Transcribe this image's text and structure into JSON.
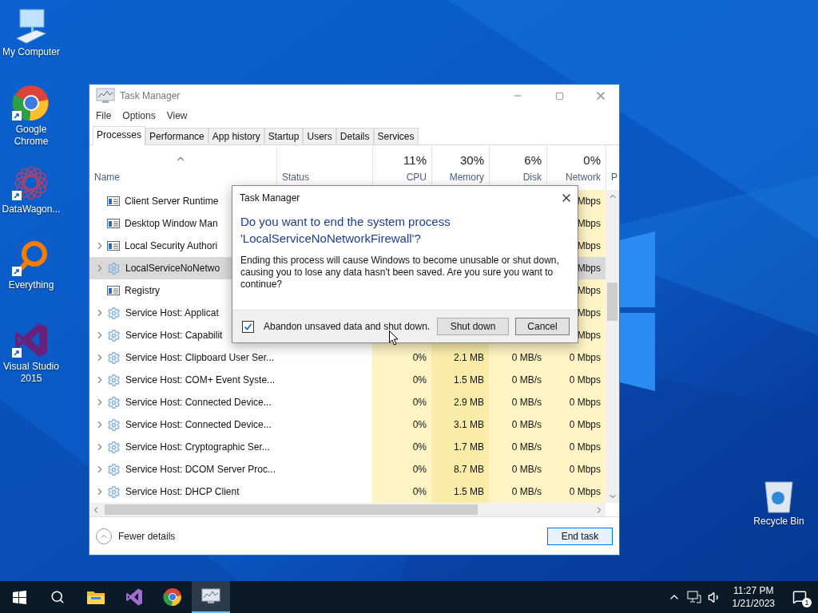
{
  "desktop_icons": [
    {
      "label": "My Computer",
      "kind": "computer",
      "shortcut": false
    },
    {
      "label": "Google Chrome",
      "kind": "browser",
      "shortcut": true
    },
    {
      "label": "DataWagon...",
      "kind": "rosette",
      "shortcut": true
    },
    {
      "label": "Everything",
      "kind": "magnifier",
      "shortcut": true
    },
    {
      "label": "Visual Studio 2015",
      "kind": "studio",
      "shortcut": true
    }
  ],
  "recycle_bin": {
    "label": "Recycle Bin"
  },
  "task_manager": {
    "title": "Task Manager",
    "menu": [
      "File",
      "Options",
      "View"
    ],
    "tabs": [
      {
        "label": "Processes",
        "selected": true
      },
      {
        "label": "Performance",
        "selected": false
      },
      {
        "label": "App history",
        "selected": false
      },
      {
        "label": "Startup",
        "selected": false
      },
      {
        "label": "Users",
        "selected": false
      },
      {
        "label": "Details",
        "selected": false
      },
      {
        "label": "Services",
        "selected": false
      }
    ],
    "columns": [
      {
        "label": "Name"
      },
      {
        "label": "Status"
      },
      {
        "usage": "11%",
        "label": "CPU"
      },
      {
        "usage": "30%",
        "label": "Memory"
      },
      {
        "usage": "6%",
        "label": "Disk"
      },
      {
        "usage": "0%",
        "label": "Network"
      },
      {
        "label": "P"
      }
    ],
    "rows": [
      {
        "name": "Client Server Runtime",
        "kind": "app",
        "expandable": false,
        "selected": false,
        "network": "Mbps"
      },
      {
        "name": "Desktop Window Man",
        "kind": "app",
        "expandable": false,
        "selected": false,
        "network": "Mbps"
      },
      {
        "name": "Local Security Authori",
        "kind": "app",
        "expandable": true,
        "selected": false,
        "network": "Mbps"
      },
      {
        "name": "LocalServiceNoNetwo",
        "kind": "service",
        "expandable": true,
        "selected": true,
        "network": "Mbps"
      },
      {
        "name": "Registry",
        "kind": "app",
        "expandable": false,
        "selected": false,
        "network": "Mbps"
      },
      {
        "name": "Service Host: Applicat",
        "kind": "service",
        "expandable": true,
        "selected": false,
        "network": "Mbps"
      },
      {
        "name": "Service Host: Capabilit",
        "kind": "service",
        "expandable": true,
        "selected": false,
        "network": "Mbps"
      },
      {
        "name": "Service Host: Clipboard User Ser...",
        "kind": "service",
        "expandable": true,
        "selected": false,
        "cpu": "0%",
        "memory": "2.1 MB",
        "disk": "0 MB/s",
        "network": "0 Mbps"
      },
      {
        "name": "Service Host: COM+ Event Syste...",
        "kind": "service",
        "expandable": true,
        "selected": false,
        "cpu": "0%",
        "memory": "1.5 MB",
        "disk": "0 MB/s",
        "network": "0 Mbps"
      },
      {
        "name": "Service Host: Connected Device...",
        "kind": "service",
        "expandable": true,
        "selected": false,
        "cpu": "0%",
        "memory": "2.9 MB",
        "disk": "0 MB/s",
        "network": "0 Mbps"
      },
      {
        "name": "Service Host: Connected Device...",
        "kind": "service",
        "expandable": true,
        "selected": false,
        "cpu": "0%",
        "memory": "3.1 MB",
        "disk": "0 MB/s",
        "network": "0 Mbps"
      },
      {
        "name": "Service Host: Cryptographic Ser...",
        "kind": "service",
        "expandable": true,
        "selected": false,
        "cpu": "0%",
        "memory": "1.7 MB",
        "disk": "0 MB/s",
        "network": "0 Mbps"
      },
      {
        "name": "Service Host: DCOM Server Proc...",
        "kind": "service",
        "expandable": true,
        "selected": false,
        "cpu": "0%",
        "memory": "8.7 MB",
        "disk": "0 MB/s",
        "network": "0 Mbps"
      },
      {
        "name": "Service Host: DHCP Client",
        "kind": "service",
        "expandable": true,
        "selected": false,
        "cpu": "0%",
        "memory": "1.5 MB",
        "disk": "0 MB/s",
        "network": "0 Mbps"
      }
    ],
    "footer": {
      "toggle": "Fewer details",
      "button": "End task"
    }
  },
  "dialog": {
    "title": "Task Manager",
    "heading": "Do you want to end the system process 'LocalServiceNoNetworkFirewall'?",
    "body": "Ending this process will cause Windows to become unusable or shut down, causing you to lose any data hasn't been saved. Are you sure you want to continue?",
    "checkbox": {
      "label": "Abandon unsaved data and shut down.",
      "checked": true
    },
    "buttons": [
      "Shut down",
      "Cancel"
    ]
  },
  "taskbar": {
    "apps": [
      {
        "kind": "folder",
        "selected": false
      },
      {
        "kind": "studio",
        "selected": false
      },
      {
        "kind": "browser",
        "selected": false
      },
      {
        "kind": "monitor",
        "selected": true
      }
    ],
    "clock": {
      "time": "11:27 PM",
      "date": "1/21/2023"
    },
    "notifications": {
      "count": "1"
    }
  }
}
